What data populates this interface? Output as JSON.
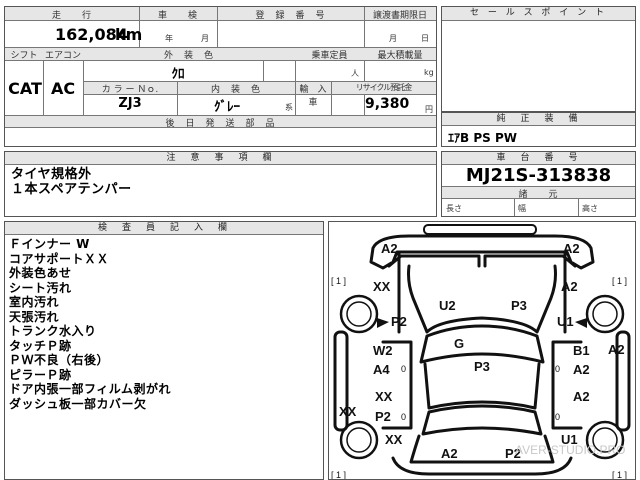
{
  "vehicle": {
    "mileage_label": "走　　行",
    "mileage_value": "162,084",
    "mileage_unit": "km",
    "inspection_label": "車　　検",
    "inspection_year": "年",
    "inspection_month": "月",
    "registration_label": "登　録　番　号",
    "transfer_deadline_label": "譲渡書期限日",
    "transfer_month": "月",
    "transfer_day": "日",
    "shift_label": "シフト",
    "shift_value": "CAT",
    "ac_label": "エアコン",
    "ac_value": "AC",
    "exterior_color_label": "外　装　色",
    "exterior_color_value": "ｸﾛ",
    "capacity_label": "乗車定員",
    "capacity_unit": "人",
    "max_load_label": "最大積載量",
    "max_load_unit": "kg",
    "color_no_label": "カ ラ ー Ｎｏ.",
    "color_no_value": "ZJ3",
    "interior_color_label": "内　装　色",
    "interior_color_value": "ｸﾞﾚｰ",
    "interior_color_unit": "系",
    "import_label": "輸　入　車",
    "recycle_label": "リサイクル預託金",
    "recycle_value": "9,380",
    "recycle_unit": "円",
    "after_parts_label": "後　日　発　送　部　品"
  },
  "sales_point": {
    "title": "セ ー ル ス ポ イ ン ト"
  },
  "genuine_equipment": {
    "title": "純　正　装　備",
    "value": "ｴｱB PS PW"
  },
  "notes": {
    "title": "注　意　事　項　欄",
    "lines": [
      "タイヤ規格外",
      "１本スペアテンパー"
    ]
  },
  "chassis": {
    "title": "車　台　番　号",
    "value": "MJ21S-313838",
    "dims_label": "諸　　元",
    "length_label": "長さ",
    "width_label": "幅",
    "height_label": "高さ"
  },
  "inspector": {
    "title": "検　査　員　記　入　欄",
    "lines": [
      "Ｆインナー W",
      "コアサポートＸＸ",
      "外装色あせ",
      "シート汚れ",
      "室内汚れ",
      "天張汚れ",
      "トランク水入り",
      "タッチＰ跡",
      "ＰＷ不良（右後）",
      "ピラーＰ跡",
      "ドア内張一部フィルム剥がれ",
      "ダッシュ板一部カバー欠"
    ]
  },
  "diagram": {
    "marks": {
      "front_left": "A2",
      "front_right": "A2",
      "fender_fl": "XX",
      "fender_fr": "A2",
      "hood_l": "U2",
      "hood_r": "P3",
      "pillar_l": "P2",
      "pillar_r": "U1",
      "windshield": "G",
      "door_fl": "W2",
      "door_fl2": "A4",
      "roof": "P3",
      "door_fr": "B1",
      "door_fr2": "A2",
      "side_r": "A2",
      "rocker_l": "XX",
      "door_rl": "XX",
      "door_rl2": "P2",
      "door_rr": "A2",
      "fender_rl": "XX",
      "fender_rr": "U1",
      "rear_l": "A2",
      "rear_r": "P2",
      "tire_tl": "[ 1 ]",
      "tire_tr": "[ 1 ]",
      "tire_bl": "[ 1 ]",
      "tire_br": "[ 1 ]",
      "zero_a": "0",
      "zero_b": "0",
      "zero_c": "0",
      "zero_d": "0"
    },
    "watermark": "AVER-STUDIO.PRO"
  }
}
